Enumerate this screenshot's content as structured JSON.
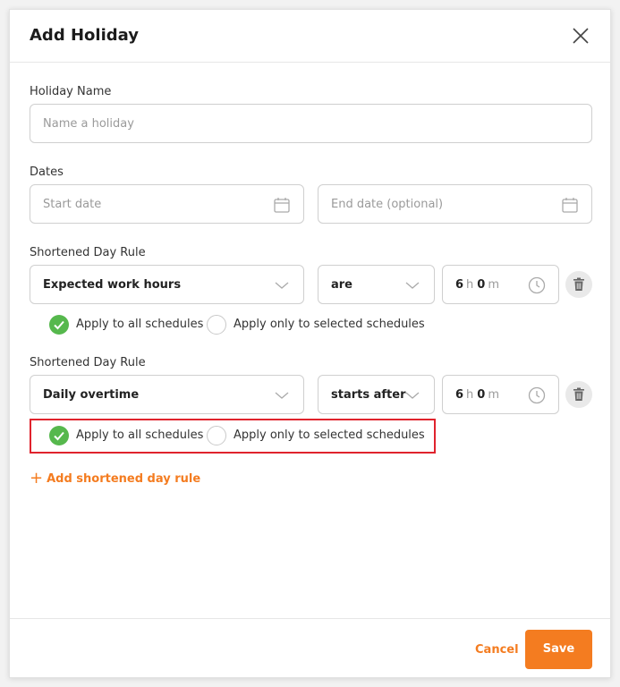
{
  "modal": {
    "title": "Add Holiday"
  },
  "holiday_name": {
    "label": "Holiday Name",
    "placeholder": "Name a holiday"
  },
  "dates": {
    "label": "Dates",
    "start_placeholder": "Start date",
    "end_placeholder": "End date (optional)"
  },
  "rules": [
    {
      "label": "Shortened Day Rule",
      "type": "Expected work hours",
      "operator": "are",
      "hours": "6",
      "hours_unit": "h",
      "minutes": "0",
      "minutes_unit": "m",
      "option_all": "Apply to all schedules",
      "option_selected": "Apply only to selected schedules",
      "selected_option": "all"
    },
    {
      "label": "Shortened Day Rule",
      "type": "Daily overtime",
      "operator": "starts after",
      "hours": "6",
      "hours_unit": "h",
      "minutes": "0",
      "minutes_unit": "m",
      "option_all": "Apply to all schedules",
      "option_selected": "Apply only to selected schedules",
      "selected_option": "all"
    }
  ],
  "add_rule_label": "Add shortened day rule",
  "footer": {
    "cancel_label": "Cancel",
    "save_label": "Save"
  },
  "colors": {
    "accent": "#f47c20",
    "check_green": "#56b84d",
    "highlight_red": "#e0232d"
  }
}
